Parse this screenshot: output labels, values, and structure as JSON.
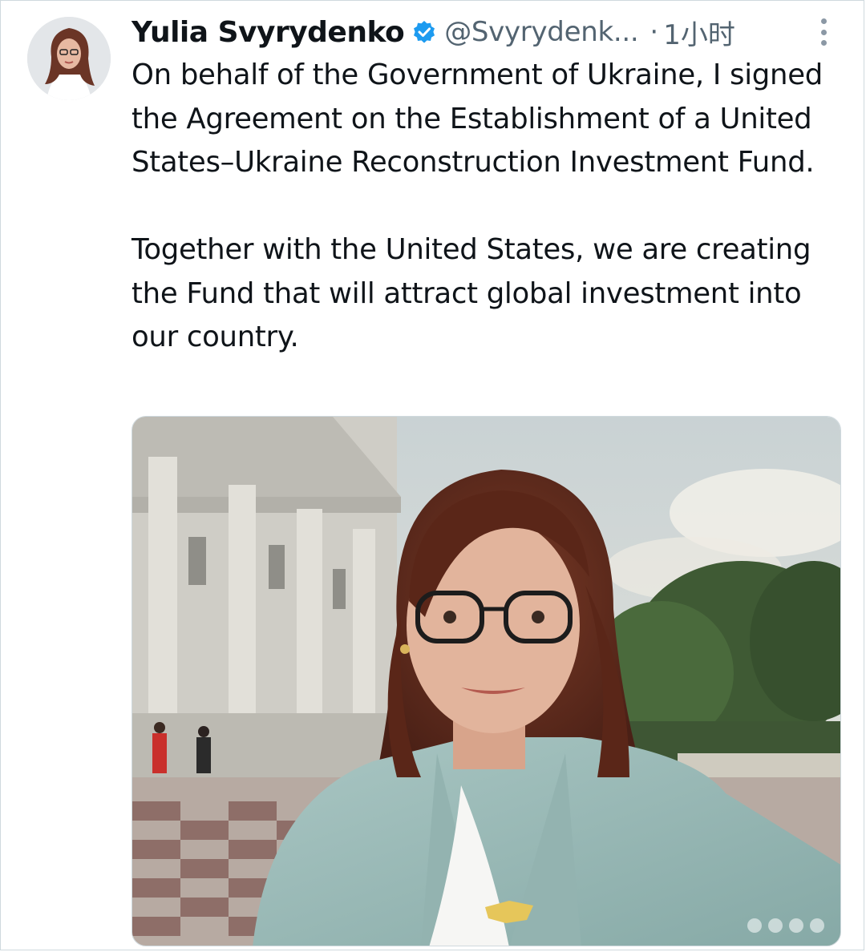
{
  "tweet": {
    "author_name": "Yulia Svyrydenko",
    "author_handle": "@Svyrydenk...",
    "separator": "·",
    "timestamp": "1小时",
    "paragraphs": [
      "On behalf of the Government of Ukraine, I signed the Agreement on the Establishment of a United States–Ukraine Reconstruction Investment Fund.",
      "Together with the United States, we are creating the Fund that will attract global investment into our country."
    ],
    "icons": {
      "verified": "verified-badge-icon",
      "more": "more-vertical-icon"
    }
  },
  "colors": {
    "text_primary": "#0f1419",
    "text_secondary": "#536471",
    "verified_badge": "#1d9bf0",
    "border": "#cfd9de"
  }
}
